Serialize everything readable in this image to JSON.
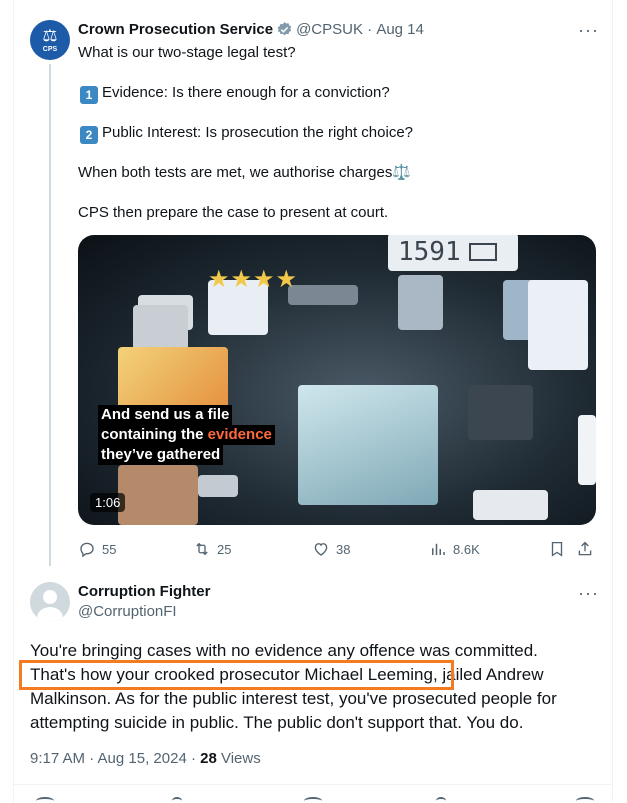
{
  "tweet": {
    "author": {
      "name": "Crown Prosecution Service",
      "handle": "@CPSUK",
      "date": "Aug 14",
      "avatar_label": "CPS",
      "avatar_icon": "scales-icon"
    },
    "lines": {
      "intro": "What is our two-stage legal test?",
      "item1_num": "1",
      "item1_text": "Evidence: Is there enough for a conviction?",
      "item2_num": "2",
      "item2_text": "Public Interest: Is prosecution the right choice?",
      "charges": "When both tests are met, we authorise charges⚖️",
      "court": "CPS then prepare the case to present at court."
    },
    "video": {
      "counter": "1591",
      "caption_line1": "And send us a file",
      "caption_line2_pre": "containing the ",
      "caption_line2_hl": "evidence",
      "caption_line3": "they’ve gathered",
      "duration": "1:06",
      "caption_highlight_color": "#ff6a3d"
    },
    "stats": {
      "replies": "55",
      "reposts": "25",
      "likes": "38",
      "views": "8.6K"
    }
  },
  "reply": {
    "name": "Corruption Fighter",
    "handle": "@CorruptionFI",
    "text_lines": [
      "You're bringing cases with no evidence any offence was committed.",
      "That's how your crooked prosecutor Michael Leeming, jailed Andrew",
      "Malkinson. As for the public interest test, you've prosecuted people for",
      "attempting suicide in public. The public don't support that. You do."
    ],
    "time": "9:17 AM · Aug 15, 2024 · ",
    "views_count": "28",
    "views_label": " Views"
  },
  "colors": {
    "accent_blue": "#1d9bf0",
    "highlight_box": "#f47b20",
    "secondary_text": "#536471"
  }
}
